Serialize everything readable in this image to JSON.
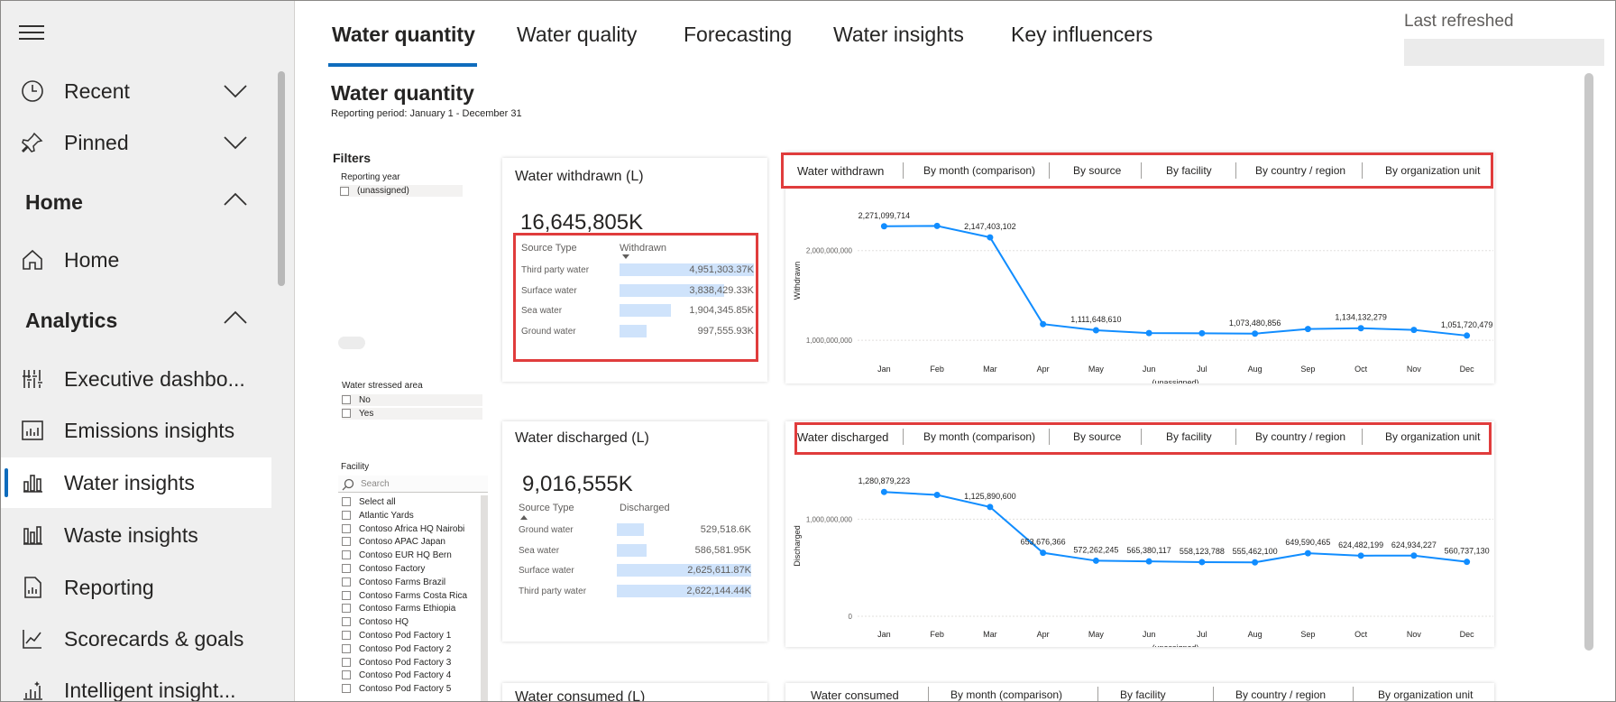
{
  "sidebar": {
    "items": [
      {
        "label": "Recent",
        "icon": "clock-icon"
      },
      {
        "label": "Pinned",
        "icon": "pin-icon"
      },
      {
        "label": "Home",
        "icon": "home-icon"
      },
      {
        "label": "Executive dashbo...",
        "icon": "dashboard-icon"
      },
      {
        "label": "Emissions insights",
        "icon": "emissions-chart-icon"
      },
      {
        "label": "Water insights",
        "icon": "water-chart-icon"
      },
      {
        "label": "Waste insights",
        "icon": "waste-chart-icon"
      },
      {
        "label": "Reporting",
        "icon": "report-icon"
      },
      {
        "label": "Scorecards & goals",
        "icon": "scorecard-icon"
      },
      {
        "label": "Intelligent insight...",
        "icon": "insight-icon"
      }
    ],
    "groups": {
      "home": "Home",
      "analytics": "Analytics"
    }
  },
  "tabs": [
    "Water quantity",
    "Water quality",
    "Forecasting",
    "Water insights",
    "Key influencers"
  ],
  "last_refreshed": "Last refreshed",
  "report": {
    "title": "Water quantity",
    "subtitle": "Reporting period: January 1 - December 31"
  },
  "filters": {
    "title": "Filters",
    "reporting_year": {
      "label": "Reporting year",
      "options": [
        "(unassigned)"
      ]
    },
    "water_stressed": {
      "label": "Water stressed area",
      "options": [
        "No",
        "Yes"
      ]
    },
    "facility": {
      "label": "Facility",
      "search_placeholder": "Search",
      "options": [
        "Select all",
        "Atlantic Yards",
        "Contoso Africa HQ Nairobi",
        "Contoso APAC Japan",
        "Contoso EUR HQ Bern",
        "Contoso Factory",
        "Contoso Farms Brazil",
        "Contoso Farms Costa Rica",
        "Contoso Farms Ethiopia",
        "Contoso HQ",
        "Contoso Pod Factory 1",
        "Contoso Pod Factory 2",
        "Contoso Pod Factory 3",
        "Contoso Pod Factory 4",
        "Contoso Pod Factory 5"
      ]
    }
  },
  "withdrawn": {
    "title": "Water withdrawn (L)",
    "total": "16,645,805K",
    "col1": "Source Type",
    "col2": "Withdrawn",
    "rows": [
      {
        "type": "Third party water",
        "value": "4,951,303.37K",
        "fraction": 1.0
      },
      {
        "type": "Surface water",
        "value": "3,838,429.33K",
        "fraction": 0.78
      },
      {
        "type": "Sea water",
        "value": "1,904,345.85K",
        "fraction": 0.38
      },
      {
        "type": "Ground water",
        "value": "997,555.93K",
        "fraction": 0.2
      }
    ]
  },
  "discharged": {
    "title": "Water discharged (L)",
    "total": "9,016,555K",
    "col1": "Source Type",
    "col2": "Discharged",
    "rows": [
      {
        "type": "Ground water",
        "value": "529,518.6K",
        "fraction": 0.2
      },
      {
        "type": "Sea water",
        "value": "586,581.95K",
        "fraction": 0.22
      },
      {
        "type": "Surface water",
        "value": "2,625,611.87K",
        "fraction": 1.0
      },
      {
        "type": "Third party water",
        "value": "2,622,144.44K",
        "fraction": 1.0
      }
    ]
  },
  "consumed": {
    "title": "Water consumed (L)"
  },
  "subtabs_withdrawn": [
    "Water withdrawn",
    "By month (comparison)",
    "By source",
    "By facility",
    "By country / region",
    "By organization unit"
  ],
  "subtabs_discharged": [
    "Water discharged",
    "By month (comparison)",
    "By source",
    "By facility",
    "By country / region",
    "By organization unit"
  ],
  "subtabs_consumed": [
    "Water consumed",
    "By month (comparison)",
    "By facility",
    "By country / region",
    "By organization unit"
  ],
  "chart_data": [
    {
      "type": "line",
      "title": "",
      "ylabel": "Withdrawn",
      "xlabel": "(unassigned)",
      "categories": [
        "Jan",
        "Feb",
        "Mar",
        "Apr",
        "May",
        "Jun",
        "Jul",
        "Aug",
        "Sep",
        "Oct",
        "Nov",
        "Dec"
      ],
      "values": [
        2271099714,
        2275000000,
        2147403102,
        1180000000,
        1111648610,
        1080000000,
        1078000000,
        1073480856,
        1125000000,
        1134132279,
        1115000000,
        1051720479
      ],
      "data_labels": {
        "0": "2,271,099,714",
        "2": "2,147,403,102",
        "4": "1,111,648,610",
        "7": "1,073,480,856",
        "9": "1,134,132,279",
        "11": "1,051,720,479"
      },
      "yticks": [
        {
          "v": 1000000000,
          "label": "1,000,000,000"
        },
        {
          "v": 2000000000,
          "label": "2,000,000,000"
        }
      ],
      "ylim": [
        880000000,
        2450000000
      ],
      "grid": true
    },
    {
      "type": "line",
      "title": "",
      "ylabel": "Discharged",
      "xlabel": "(unassigned)",
      "categories": [
        "Jan",
        "Feb",
        "Mar",
        "Apr",
        "May",
        "Jun",
        "Jul",
        "Aug",
        "Sep",
        "Oct",
        "Nov",
        "Dec"
      ],
      "values": [
        1280879223,
        1250000000,
        1125890600,
        653676366,
        572262245,
        565380117,
        558123788,
        555462100,
        649590465,
        624482199,
        624934227,
        560737130
      ],
      "data_labels": {
        "0": "1,280,879,223",
        "2": "1,125,890,600",
        "3": "653,676,366",
        "4": "572,262,245",
        "5": "565,380,117",
        "6": "558,123,788",
        "7": "555,462,100",
        "8": "649,590,465",
        "9": "624,482,199",
        "10": "624,934,227",
        "11": "560,737,130"
      },
      "yticks": [
        {
          "v": 0,
          "label": "0"
        },
        {
          "v": 1000000000,
          "label": "1,000,000,000"
        }
      ],
      "ylim": [
        0,
        1450000000
      ],
      "grid": true
    }
  ],
  "colors": {
    "accent": "#0f6cbd",
    "line": "#118dff",
    "highlight": "#e03c3c",
    "bar": "#cfe3fb"
  }
}
